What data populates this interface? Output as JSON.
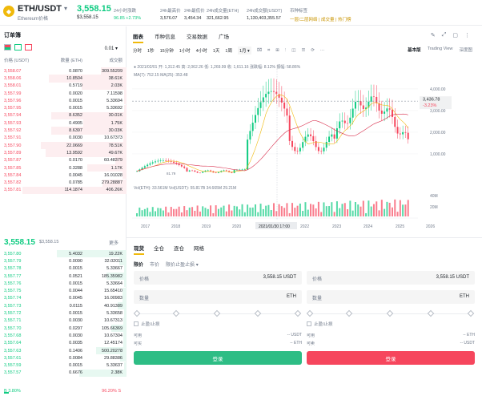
{
  "header": {
    "logo_glyph": "◆",
    "pair": "ETH/USDT",
    "pair_name": "Ethereum价格",
    "big_price": "3,558.15",
    "sub_price": "$3,558.15",
    "stats": [
      {
        "label": "24小时涨跌",
        "value": "96.85 +2.73%"
      },
      {
        "label": "24h最高价",
        "value": "3,576.07"
      },
      {
        "label": "24h最低价",
        "value": "3,454.34"
      },
      {
        "label": "24h成交量(ETH)",
        "value": "321,662.95"
      },
      {
        "label": "24h成交额(USDT)",
        "value": "1,130,403,355.57"
      },
      {
        "label": "币种标签",
        "value": "一层/二层网络 | 成交量 | 热门榜"
      }
    ]
  },
  "orderbook": {
    "title": "订单簿",
    "precision": "0.01",
    "headers": [
      "价格 (USDT)",
      "数量 (ETH)",
      "成交额"
    ],
    "asks": [
      [
        "3,558.07",
        "0.0870",
        "309.55209"
      ],
      [
        "3,558.06",
        "10.8504",
        "38.61K"
      ],
      [
        "3,558.01",
        "0.5719",
        "2.03K"
      ],
      [
        "3,557.99",
        "0.0020",
        "7.11598"
      ],
      [
        "3,557.96",
        "0.0015",
        "5.33694"
      ],
      [
        "3,557.95",
        "0.0015",
        "5.33692"
      ],
      [
        "3,557.94",
        "8.6352",
        "30.01K"
      ],
      [
        "3,557.93",
        "0.4905",
        "1.75K"
      ],
      [
        "3,557.92",
        "8.6397",
        "30.03K"
      ],
      [
        "3,557.91",
        "0.0030",
        "10.67373"
      ],
      [
        "3,557.90",
        "22.0669",
        "78.51K"
      ],
      [
        "3,557.89",
        "13.9592",
        "49.67K"
      ],
      [
        "3,557.87",
        "0.0170",
        "60.48379"
      ],
      [
        "3,557.85",
        "0.3288",
        "1.17K"
      ],
      [
        "3,557.84",
        "0.0045",
        "16.01028"
      ],
      [
        "3,557.82",
        "0.0785",
        "279.28887"
      ],
      [
        "3,557.81",
        "114.1874",
        "406.26K"
      ]
    ],
    "mid_price": "3,558.15",
    "mid_sub": "$3,558.15",
    "mid_more": "更多",
    "bids": [
      [
        "3,557.80",
        "5.4032",
        "19.22K"
      ],
      [
        "3,557.79",
        "0.0090",
        "32.02011"
      ],
      [
        "3,557.78",
        "0.0015",
        "5.33667"
      ],
      [
        "3,557.77",
        "0.0521",
        "185.35982"
      ],
      [
        "3,557.76",
        "0.0015",
        "5.33664"
      ],
      [
        "3,557.75",
        "0.0044",
        "15.65410"
      ],
      [
        "3,557.74",
        "0.0045",
        "16.00983"
      ],
      [
        "3,557.73",
        "0.0115",
        "40.91389"
      ],
      [
        "3,557.72",
        "0.0015",
        "5.33658"
      ],
      [
        "3,557.71",
        "0.0030",
        "10.67313"
      ],
      [
        "3,557.70",
        "0.0297",
        "105.66369"
      ],
      [
        "3,557.68",
        "0.0030",
        "10.67304"
      ],
      [
        "3,557.64",
        "0.0035",
        "12.45174"
      ],
      [
        "3,557.63",
        "0.1406",
        "500.20278"
      ],
      [
        "3,557.61",
        "0.0084",
        "29.88386"
      ],
      [
        "3,557.59",
        "0.0015",
        "5.33637"
      ],
      [
        "3,557.57",
        "0.6676",
        "2.38K"
      ]
    ],
    "buy_ratio": "B 3.80%",
    "sell_ratio": "96.20% S",
    "buy_pct": 3.8
  },
  "tabs": [
    "图表",
    "币种信息",
    "交易数据",
    "广场"
  ],
  "top_icons": [
    "✎",
    "⤢",
    "▢",
    "⋮"
  ],
  "timeframes": [
    "分时",
    "1秒",
    "15分钟",
    "1小时",
    "4小时",
    "1天",
    "1周",
    "1月 ▾"
  ],
  "timeframe_tools": [
    "⌧",
    "⌗",
    "⊞",
    "⫶",
    "◫",
    "☰",
    "⟳",
    "⋯"
  ],
  "views": [
    "基本版",
    "Trading View",
    "深度图"
  ],
  "ohlc": "● 2021/02/01  开: 1,312.45  高: 2,062.26  低: 1,269.99  收: 1,611.16  涨跌幅: 8.12%  振幅: 58.86%",
  "ma_line": "MA(7): 752.15   MA(25): 353.48",
  "vol_line": "Vol(ETH): 33.561M   Vol(USDT): 55.817B   34.665M   29.21M",
  "chart_data": {
    "type": "candlestick",
    "x_ticks": [
      "2017",
      "2018",
      "2019",
      "2020",
      "2021/01/30 17:00",
      "2022",
      "2023",
      "2024",
      "2025",
      "2026"
    ],
    "y_ticks": [
      1000,
      2000,
      3000,
      4000
    ],
    "y_tick_labels": [
      "1,000.00",
      "2,000.00",
      "3,000.00",
      "4,000.00"
    ],
    "ylim": [
      0,
      4700
    ],
    "current_price": "3,436.78",
    "current_change": "-3.23%",
    "vol_ticks": [
      "40M",
      "20M"
    ],
    "low_label": "81.79"
  },
  "form": {
    "tabs": [
      "现货",
      "全仓",
      "逐仓",
      "网格"
    ],
    "types": [
      "限价",
      "市价",
      "限价止盈止损 ▾"
    ],
    "price_label": "价格",
    "price_value": "3,558.15  USDT",
    "qty_label": "数量",
    "qty_unit": "ETH",
    "tpsl": "止盈/止损",
    "avail_label": "可用",
    "avail_buy": "-- USDT",
    "avail_sell": "-- ETH",
    "max_label": "可买",
    "max_sell_label": "可卖",
    "max_buy": "-- ETH",
    "max_sell": "-- USDT",
    "buy_btn": "登录",
    "sell_btn": "登录",
    "buy_color": "#2ebd85",
    "sell_color": "#f6465d"
  }
}
